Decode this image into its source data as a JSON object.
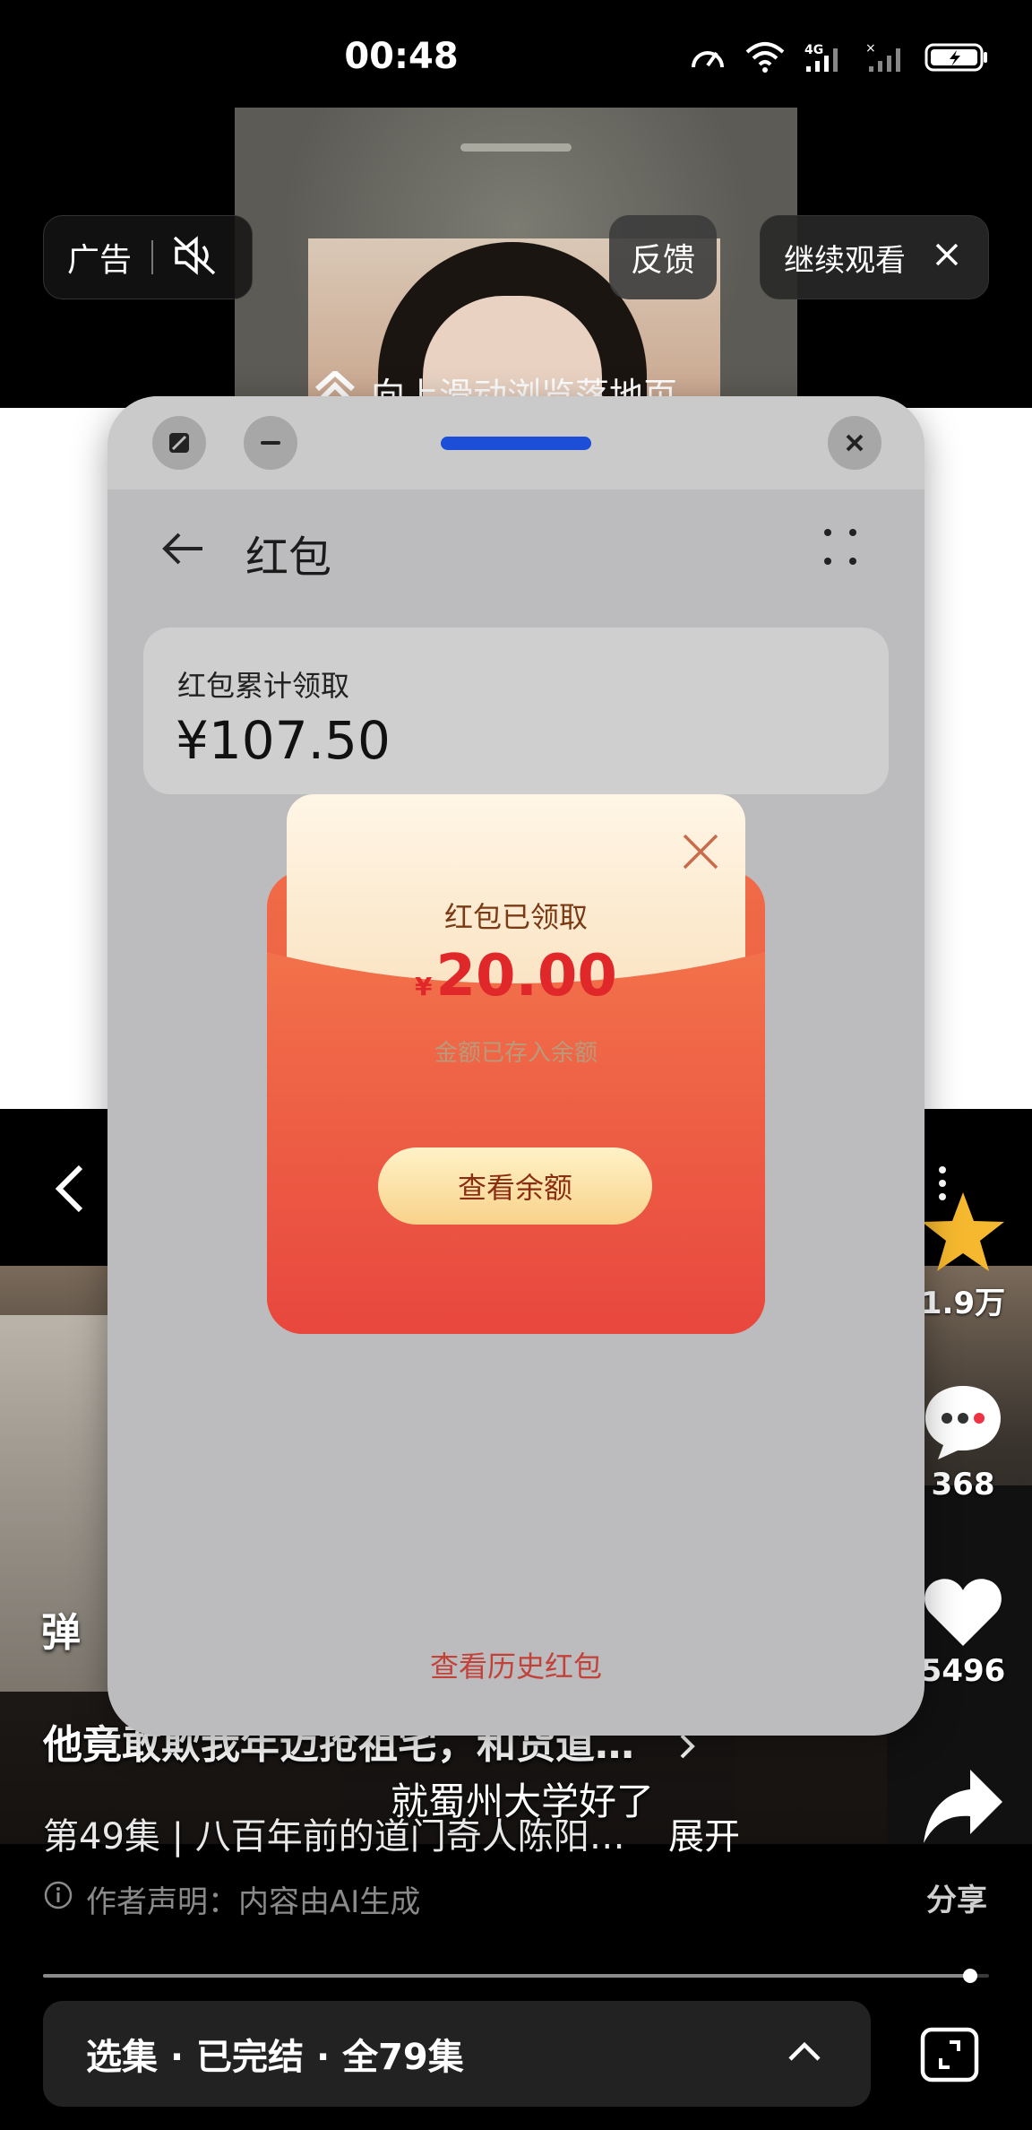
{
  "status_bar": {
    "time": "00:48",
    "icons": [
      "speed-icon",
      "wifi-icon",
      "signal-4g-icon",
      "signal-icon",
      "battery-charging-icon"
    ]
  },
  "ad": {
    "label": "广告",
    "mute_icon": "speaker-muted-icon",
    "feedback_label": "反馈",
    "continue_label": "继续观看",
    "swipe_hint": "向上滑动浏览落地页"
  },
  "drama": {
    "title": "他竟敢欺我年迈抢祖宅，和货道…",
    "subtitle": "就蜀州大学好了",
    "episode_info": "第49集 | 八百年前的道门奇人陈阳…",
    "expand_label": "展开",
    "disclaimer": "作者声明：内容由AI生成",
    "danmaku_partial": "弹",
    "actions": {
      "favorite_count": "1.9万",
      "comment_count": "368",
      "like_count": "5496",
      "share_label": "分享"
    },
    "progress": 0.98,
    "episodes_label": "选集 · 已完结 · 全79集"
  },
  "floating_window": {
    "page_title": "红包",
    "summary_label": "红包累计领取",
    "summary_amount": "¥107.50",
    "history_link": "查看历史红包"
  },
  "red_packet": {
    "title": "红包已领取",
    "currency": "¥",
    "amount": "20.00",
    "note": "金额已存入余额",
    "button_label": "查看余额"
  },
  "colors": {
    "accent_blue": "#1d4ed8",
    "envelope_red": "#e9503f",
    "amount_red": "#e0282a",
    "star_yellow": "#f5b82e"
  }
}
